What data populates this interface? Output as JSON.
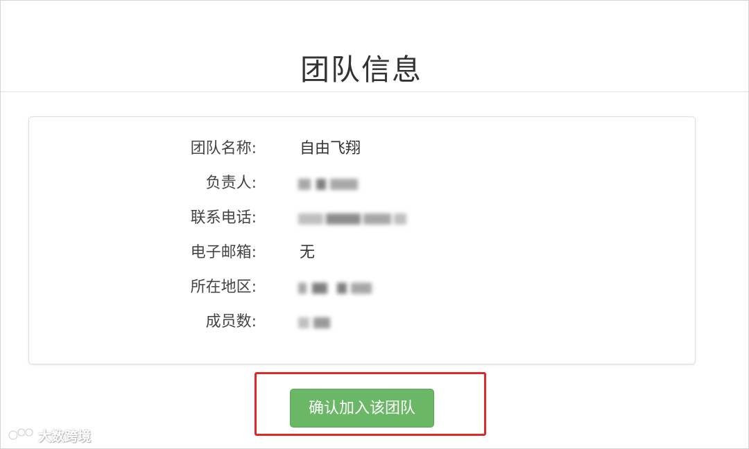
{
  "page": {
    "title": "团队信息"
  },
  "team_info": {
    "rows": [
      {
        "label": "团队名称:",
        "value": "自由飞翔",
        "redacted": false
      },
      {
        "label": "负责人:",
        "value": "",
        "redacted": true
      },
      {
        "label": "联系电话:",
        "value": "",
        "redacted": true
      },
      {
        "label": "电子邮箱:",
        "value": "无",
        "redacted": false
      },
      {
        "label": "所在地区:",
        "value": "",
        "redacted": true
      },
      {
        "label": "成员数:",
        "value": "",
        "redacted": true
      }
    ]
  },
  "actions": {
    "confirm_label": "确认加入该团队"
  },
  "annotation": {
    "highlight_color": "#e02828"
  },
  "watermark": {
    "text": "大数跨境",
    "icon": "brand-logo-icon"
  },
  "colors": {
    "button_bg": "#6ab865",
    "text": "#333333"
  }
}
